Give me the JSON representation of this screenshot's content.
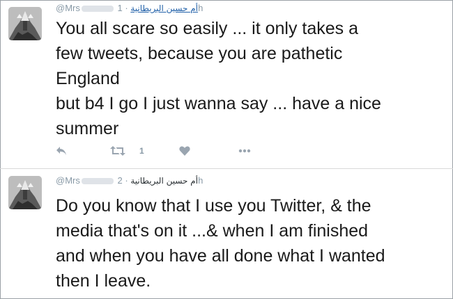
{
  "tweets": [
    {
      "handle": "@Mrs",
      "display_name": "أم حسين البريطانية",
      "separator": "·",
      "time": "1h",
      "text": "You all scare so easily ... it only takes a\nfew tweets, because you are pathetic\nEngland\nbut b4 I go I just wanna say ... have a nice\nsummer",
      "retweet_count": "1",
      "actions": [
        "reply-icon",
        "retweet-icon",
        "like-icon",
        "more-icon"
      ]
    },
    {
      "handle": "@Mrs",
      "display_name": "أم حسين البريطانية",
      "separator": "·",
      "time": "2h",
      "text": "Do you know that I use you Twitter, & the\nmedia that's on it ...& when I am finished\nand when you have all done what I wanted\nthen I leave."
    }
  ],
  "colors": {
    "link": "#1f5fa8",
    "meta": "#8899a6",
    "icon": "#9aa5b0"
  }
}
